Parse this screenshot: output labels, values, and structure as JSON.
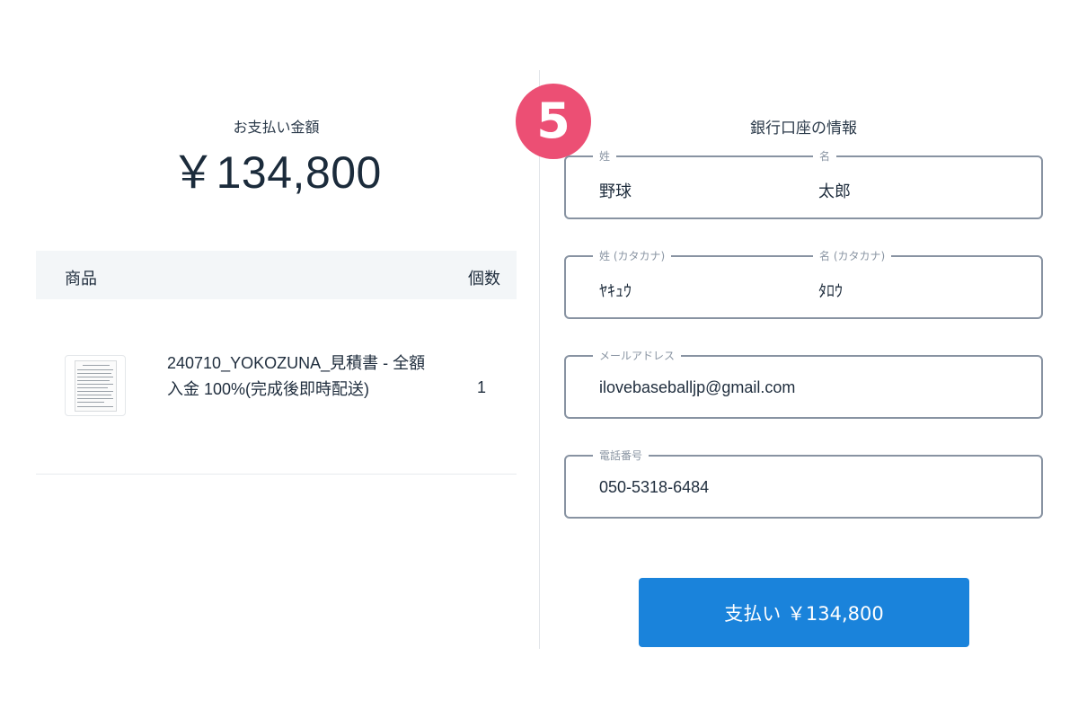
{
  "payment": {
    "label": "お支払い金額",
    "amount": "￥134,800"
  },
  "table": {
    "col_product": "商品",
    "col_qty": "個数",
    "items": [
      {
        "name": "240710_YOKOZUNA_見積書 - 全額入金 100%(完成後即時配送)",
        "qty": "1",
        "thumbnail": "document-thumbnail-icon"
      }
    ]
  },
  "step_badge": "5",
  "bank": {
    "title": "銀行口座の情報",
    "last_name": {
      "label": "姓",
      "value": "野球"
    },
    "first_name": {
      "label": "名",
      "value": "太郎"
    },
    "last_name_kana": {
      "label": "姓 (カタカナ)",
      "value": "ﾔｷｭｳ"
    },
    "first_name_kana": {
      "label": "名 (カタカナ)",
      "value": "ﾀﾛｳ"
    },
    "email": {
      "label": "メールアドレス",
      "value": "ilovebaseballjp@gmail.com"
    },
    "phone": {
      "label": "電話番号",
      "value": "050-5318-6484"
    }
  },
  "pay_button": "支払い ￥134,800",
  "colors": {
    "badge": "#ec4f74",
    "button": "#1a83db",
    "field_border": "#8893a2",
    "table_header_bg": "#f3f6f8"
  }
}
